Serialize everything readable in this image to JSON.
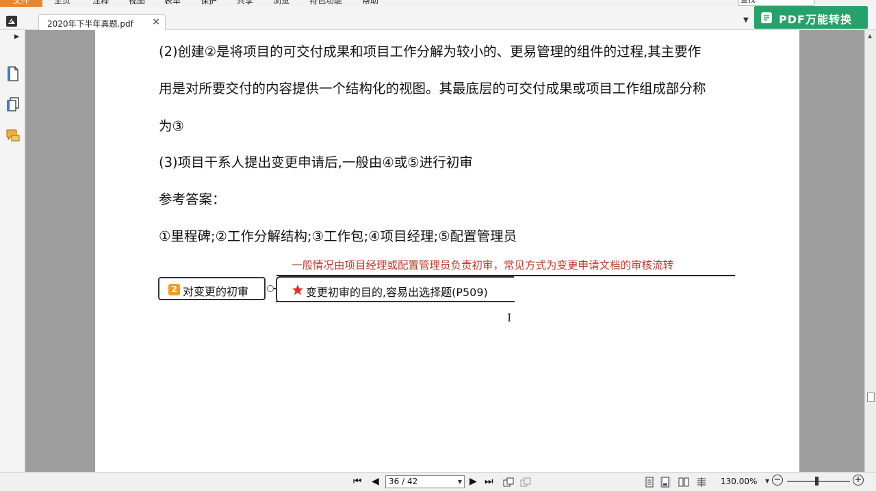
{
  "menubar": {
    "file": "文件",
    "items": [
      "主页",
      "注释",
      "视图",
      "表单",
      "保护",
      "共享",
      "浏览",
      "特色功能",
      "帮助"
    ],
    "search_value": "查找"
  },
  "tab": {
    "title": "2020年下半年真题.pdf",
    "close": "×",
    "dropdown": "▼"
  },
  "pdf_convert": {
    "label": "PDF万能转换"
  },
  "content": {
    "lines": [
      "(2)创建②是将项目的可交付成果和项目工作分解为较小的、更易管理的组件的过程,其主要作",
      "用是对所要交付的内容提供一个结构化的视图。其最底层的可交付成果或项目工作组成部分称",
      "为③",
      "(3)项目干系人提出变更申请后,一般由④或⑤进行初审",
      "参考答案：",
      "①里程碑;②工作分解结构;③工作包;④项目经理;⑤配置管理员"
    ],
    "red_note": "一般情况由项目经理或配置管理员负责初审，常见方式为变更申请文档的审核流转",
    "node_badge": "2",
    "node_initial": "对变更的初审",
    "node_purpose": "变更初审的目的,容易出选择题(P509)"
  },
  "status": {
    "page_value": "36 / 42",
    "zoom": "130.00%",
    "zoom_level": 0.47
  },
  "colors": {
    "accent_file_tab": "#e8862d",
    "pdf_button": "#27a16a",
    "red_note": "#c0392b",
    "badge": "#f0a020",
    "star": "#e03030"
  }
}
